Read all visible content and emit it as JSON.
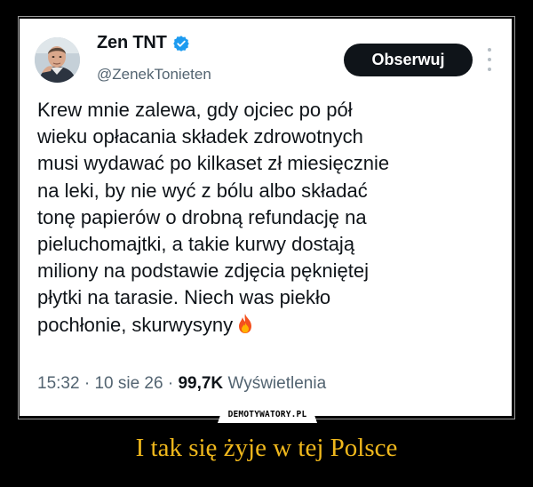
{
  "tweet": {
    "author_name": "Zen TNT",
    "handle": "@ZenekTonieten",
    "follow_label": "Obserwuj",
    "text_lines": [
      "Krew mnie zalewa, gdy ojciec po pół",
      "wieku opłacania składek zdrowotnych",
      "musi wydawać po kilkaset zł miesięcznie",
      "na leki, by nie wyć z bólu albo składać",
      "tonę papierów o drobną refundację na",
      "pieluchomajtki, a takie kurwy dostają",
      "miliony na podstawie zdjęcia pękniętej",
      "płytki na tarasie. Niech was piekło",
      "pochłonie, skurwysyny"
    ],
    "time": "15:32",
    "date": "10 sie 26",
    "views_count": "99,7K",
    "views_label": "Wyświetlenia",
    "separator": "·"
  },
  "icons": {
    "verified": "verified-badge-icon",
    "more": "more-options-icon",
    "emoji": "fire-emoji-icon"
  },
  "colors": {
    "verified_blue": "#1d9bf0",
    "caption_yellow": "#f0b81c",
    "follow_button": "#0f1419",
    "secondary_text": "#536471"
  },
  "watermark": "DEMOTYWATORY.PL",
  "caption": "I tak się żyje w tej Polsce"
}
